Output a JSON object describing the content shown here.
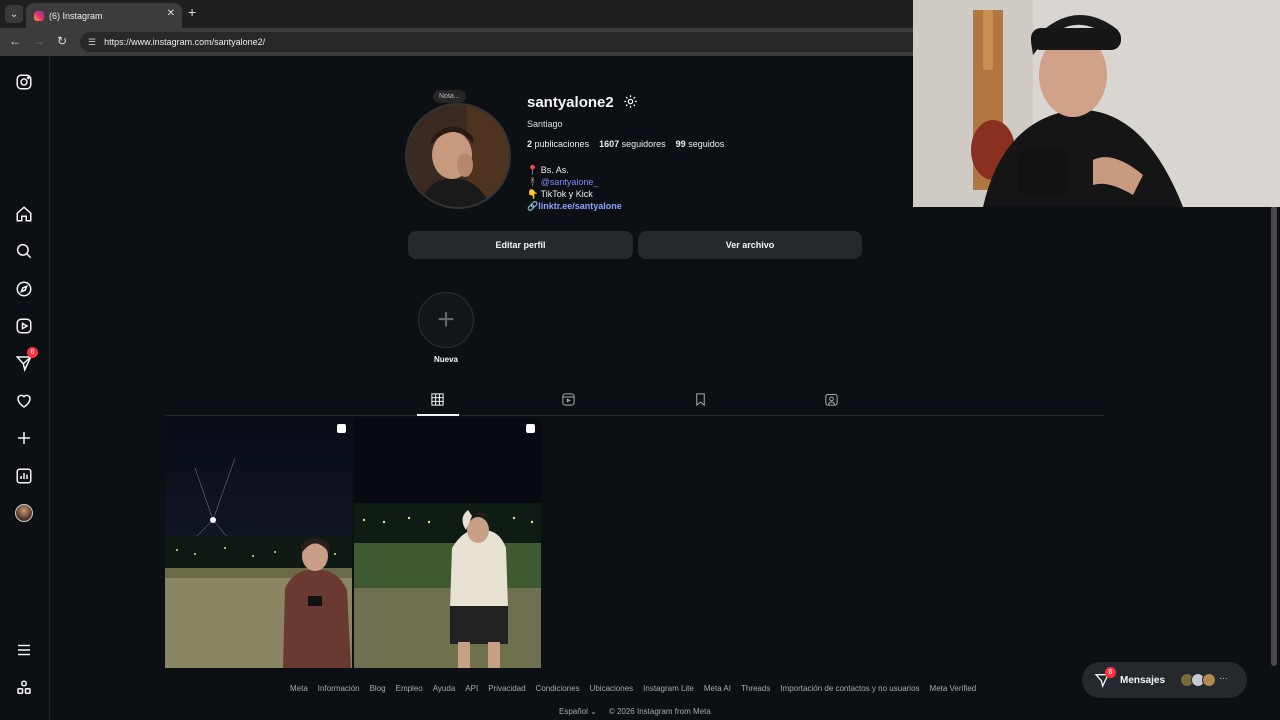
{
  "browser": {
    "tab_title": "(6) Instagram",
    "tab_close": "✕",
    "new_tab": "+",
    "url": "https://www.instagram.com/santyalone2/"
  },
  "sidebar": {
    "items": [
      {
        "name": "instagram-logo-icon"
      },
      {
        "name": "home-icon"
      },
      {
        "name": "search-icon"
      },
      {
        "name": "explore-icon"
      },
      {
        "name": "reels-icon"
      },
      {
        "name": "messages-icon",
        "badge": "6"
      },
      {
        "name": "notifications-heart-icon"
      },
      {
        "name": "create-plus-icon"
      },
      {
        "name": "dashboard-icon"
      },
      {
        "name": "profile-avatar"
      },
      {
        "name": "more-menu-icon"
      },
      {
        "name": "also-from-meta-icon"
      }
    ]
  },
  "profile": {
    "note": "Nota...",
    "username": "santyalone2",
    "full_name": "Santiago",
    "posts_count": "2",
    "posts_label": "publicaciones",
    "followers_count": "1607",
    "followers_label": "seguidores",
    "following_count": "99",
    "following_label": "seguidos",
    "bio_line1": "📍 Bs. As.",
    "bio_line2_prefix": "🕴",
    "bio_line2_mention": "@santyalone_",
    "bio_line3": "👇 TikTok y Kick",
    "bio_link": "linktr.ee/santyalone",
    "edit_button": "Editar perfil",
    "archive_button": "Ver archivo",
    "highlight_new": "Nueva"
  },
  "tabs": [
    {
      "name": "tab-posts-grid",
      "active": true
    },
    {
      "name": "tab-reels",
      "active": false
    },
    {
      "name": "tab-saved",
      "active": false
    },
    {
      "name": "tab-tagged",
      "active": false
    }
  ],
  "footer": {
    "links": [
      "Meta",
      "Información",
      "Blog",
      "Empleo",
      "Ayuda",
      "API",
      "Privacidad",
      "Condiciones",
      "Ubicaciones",
      "Instagram Lite",
      "Meta AI",
      "Threads",
      "Importación de contactos y no usuarios",
      "Meta Verified"
    ],
    "language": "Español ⌄",
    "copyright": "© 2026 Instagram from Meta"
  },
  "messages_button": {
    "label": "Mensajes",
    "badge": "6",
    "more": "···"
  },
  "colors": {
    "background": "#0c1014",
    "button": "#25292e",
    "badge": "#ff3040",
    "link": "#8aa4ff"
  }
}
